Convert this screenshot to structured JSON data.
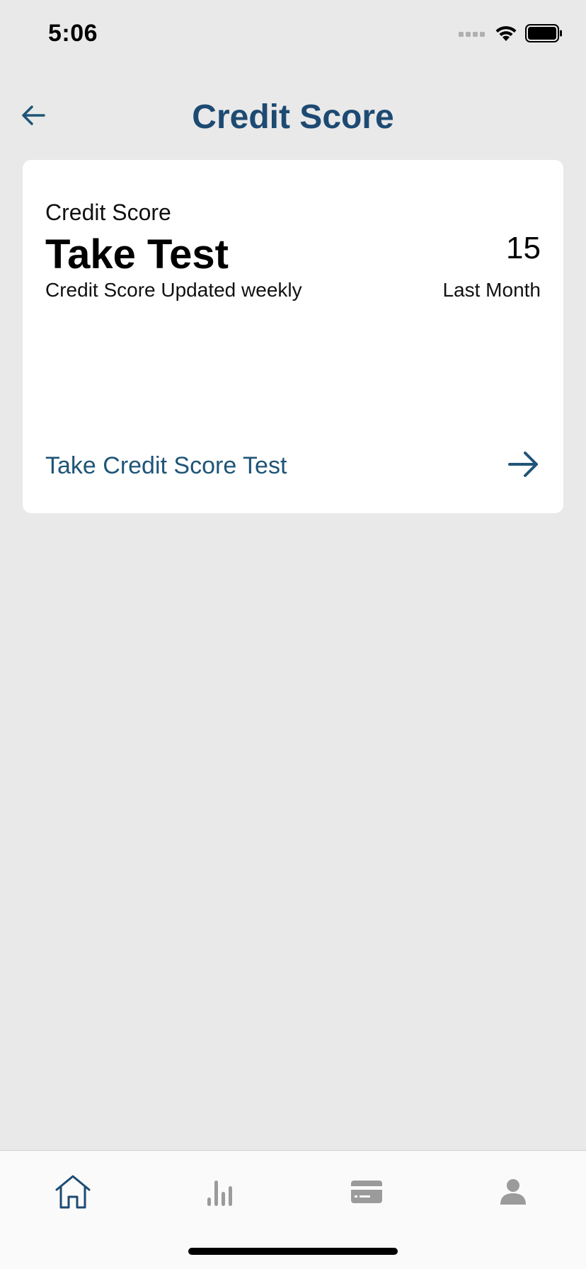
{
  "status_bar": {
    "time": "5:06",
    "icons": [
      "cellular-signal-icon",
      "wifi-icon",
      "battery-icon"
    ]
  },
  "header": {
    "title": "Credit Score",
    "back_icon": "arrow-left-icon"
  },
  "card": {
    "label": "Credit Score",
    "main_text": "Take Test",
    "subtitle": "Credit Score Updated weekly",
    "value": "15",
    "value_caption": "Last Month",
    "link_label": "Take Credit Score Test",
    "link_icon": "arrow-right-icon"
  },
  "tab_bar": {
    "tabs": [
      {
        "icon": "home-icon",
        "active": true
      },
      {
        "icon": "bar-chart-icon",
        "active": false
      },
      {
        "icon": "credit-card-icon",
        "active": false
      },
      {
        "icon": "profile-icon",
        "active": false
      }
    ]
  },
  "colors": {
    "accent": "#1d4a72",
    "link": "#1f5577",
    "background": "#e9e9e9",
    "inactive_icon": "#9b9b9b"
  }
}
